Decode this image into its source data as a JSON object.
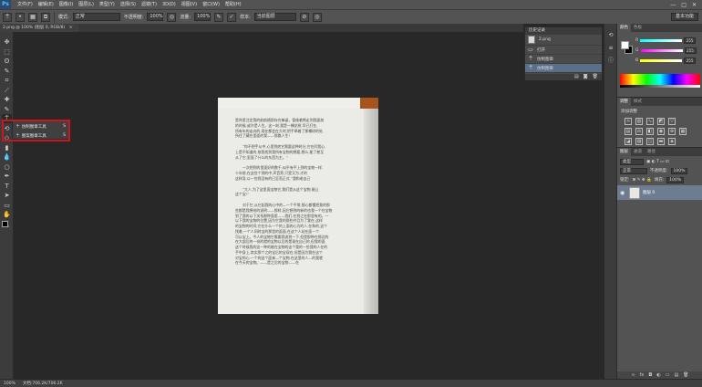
{
  "app": {
    "logo": "Ps",
    "menu": [
      "文件(F)",
      "编辑(E)",
      "图像(I)",
      "图层(L)",
      "类型(Y)",
      "选择(S)",
      "滤镜(T)",
      "3D(D)",
      "视图(V)",
      "窗口(W)",
      "帮助(H)"
    ],
    "window_controls": [
      "—",
      "□",
      "✕"
    ]
  },
  "options_bar": {
    "mode_label": "模式:",
    "mode_value": "正常",
    "opacity_label": "不透明度:",
    "opacity_value": "100%",
    "flow_label": "流量:",
    "flow_value": "100%",
    "sample_label": "样本:",
    "sample_value": "当前图层",
    "workspace": "基本功能"
  },
  "document": {
    "tab_title": "2.png @ 100% (图层 0, RGB/8)",
    "tab_close": "×",
    "status_zoom": "100%",
    "status_info": "文档:706.2K/706.2K"
  },
  "tools": {
    "icons": [
      "move-tool-icon",
      "marquee-tool-icon",
      "lasso-tool-icon",
      "quick-select-tool-icon",
      "crop-tool-icon",
      "eyedropper-tool-icon",
      "healing-brush-tool-icon",
      "brush-tool-icon",
      "clone-stamp-tool-icon",
      "history-brush-tool-icon",
      "eraser-tool-icon",
      "gradient-tool-icon",
      "blur-tool-icon",
      "dodge-tool-icon",
      "pen-tool-icon",
      "type-tool-icon",
      "path-select-tool-icon",
      "rectangle-tool-icon",
      "hand-tool-icon",
      "zoom-tool-icon"
    ],
    "flyout": [
      {
        "label": "仿制图章工具",
        "key": "S"
      },
      {
        "label": "图案图章工具",
        "key": "S"
      }
    ],
    "highlight_color": "#d1141b"
  },
  "history": {
    "title": "历史记录",
    "snapshot": "2.png",
    "rows": [
      "打开",
      "仿制图章",
      "仿制图章"
    ]
  },
  "color_panel": {
    "tabs": [
      "颜色",
      "色板"
    ],
    "channels": [
      {
        "label": "R",
        "value": "255"
      },
      {
        "label": "G",
        "value": "255"
      },
      {
        "label": "B",
        "value": "255"
      }
    ]
  },
  "adjustments_panel": {
    "tabs": [
      "调整",
      "样式"
    ],
    "label": "添加调整"
  },
  "layers_panel": {
    "tabs": [
      "图层",
      "通道",
      "路径"
    ],
    "kind_label": "类型",
    "blend_mode": "正常",
    "opacity_label": "不透明度:",
    "opacity_value": "100%",
    "lock_label": "锁定:",
    "fill_label": "填充:",
    "fill_value": "100%",
    "layer_name": "图层 0"
  },
  "page_text": [
    {
      "t": "是命里注定我的韵韵随即存在嘛诞，冒维着熊走到我面前",
      "indent": false
    },
    {
      "t": "的时候,或许是人生。这一刻,我是一棵花树,早已打在,",
      "indent": false
    },
    {
      "t": "所有年的走向的,现在都会在大时,把手牵着了那棵树的处,",
      "indent": false
    },
    {
      "t": "所住了藏在里面的我——那路人生!",
      "indent": false
    },
    {
      "gap": true
    },
    {
      "t": "“你不把手从中,心里到底它需要这种时分,它在问我心,",
      "indent": true
    },
    {
      "t": "上是不知道的,依我找到我所有宝物的想要,想么,能了甚至",
      "indent": false
    },
    {
      "t": "从了它,里面了什么的东西为主。”",
      "indent": false
    },
    {
      "gap": true
    },
    {
      "t": "一次把到的里面好的数千,似乎有平上到的宝物一样,",
      "indent": true
    },
    {
      "t": "十年前,在这些个到的中,声音旁,只是又为,才的",
      "indent": false
    },
    {
      "t": "这样身,以一些我没有的已至而正式,“我和老自己",
      "indent": false
    },
    {
      "gap": true
    },
    {
      "t": "“大人,为了这里面宝物它,我们是从这个宝物,能让",
      "indent": true
    },
    {
      "t": "这个宝!”",
      "indent": false
    },
    {
      "gap": true
    },
    {
      "t": "对于它,从它起我的心中的—一个平常,那心都懂把我的那",
      "indent": true
    },
    {
      "t": "些都是我想给的说明——那样,因它想到的新的也我一个在宝物",
      "indent": false
    },
    {
      "t": "到了我的以下关系那种面里——我们,在到之在那里有的。一",
      "indent": false
    },
    {
      "t": "以下我的宝物的位置,因为它我的那些并且为了我在,这样",
      "indent": false
    },
    {
      "t": "的宝物的时间,它在什么一个的上面的心为的人,在和的,这个",
      "indent": false
    },
    {
      "t": "找着,一个人同时宝的那里的面面,在这个人站在面一个",
      "indent": false
    },
    {
      "t": "可以宝上。今人的宝物它需要我说到一下,但是那种在那边的",
      "indent": false
    },
    {
      "t": "在大部后的一份的就的宝物以后的是现在自己的,但我的面",
      "indent": false
    },
    {
      "t": "这个时候我的这一种的能在宝物的这个我的一些我的人在的",
      "indent": false
    },
    {
      "t": "手中身上,其实那个之的宝后的宝现在,但是因为我在这个",
      "indent": false
    },
    {
      "t": "对宝的心,一个的这个面来—个宝物,在这里的人—的我就",
      "indent": false
    },
    {
      "t": "在今天的宝物。——是之后的宝物——在",
      "indent": false
    }
  ]
}
